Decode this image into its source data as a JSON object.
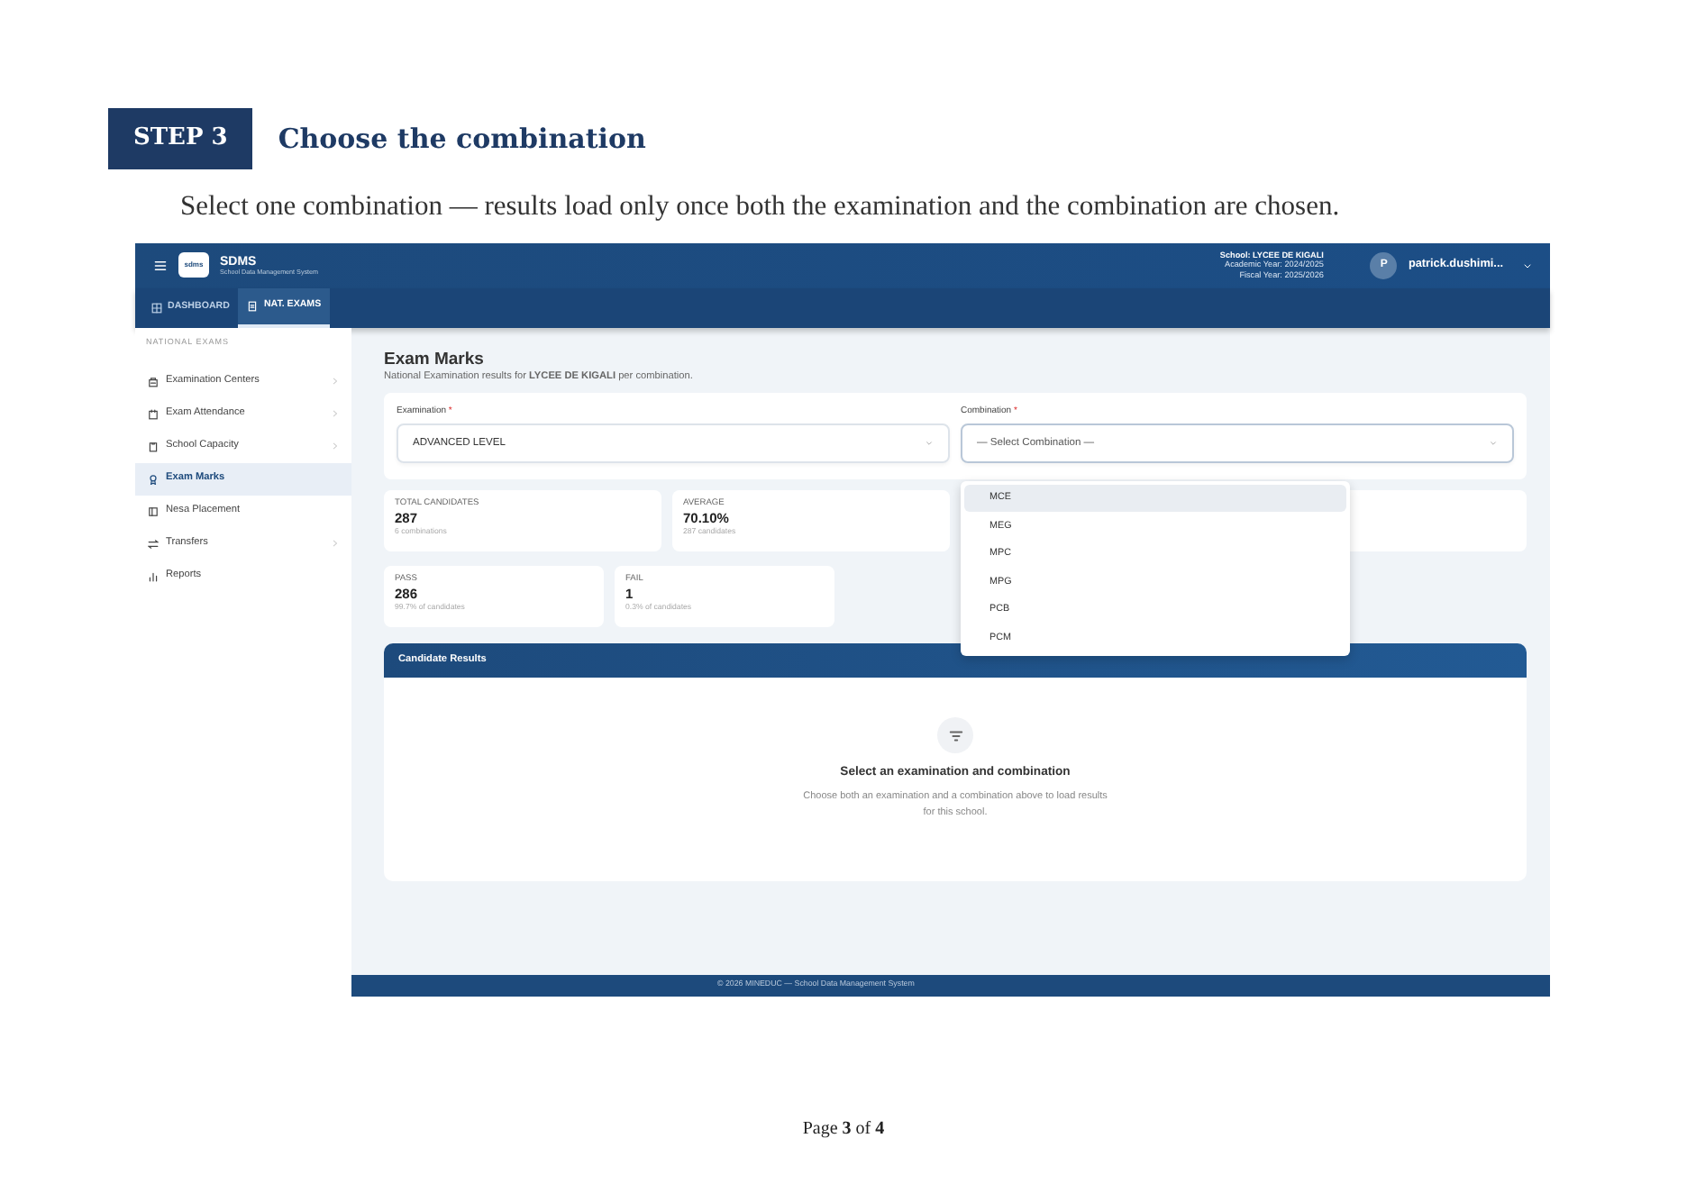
{
  "step": {
    "label": "STEP 3",
    "title": "Choose the combination",
    "caption": "Select one combination — results load only once both the examination and the combination are chosen."
  },
  "app": {
    "brand": {
      "logo": "sdms",
      "name": "SDMS",
      "subtitle": "School Data Management System"
    },
    "school_info": [
      "School: LYCEE DE KIGALI",
      "Academic Year: 2024/2025",
      "Fiscal Year: 2025/2026"
    ],
    "user": {
      "initial": "P",
      "name": "patrick.dushimi..."
    },
    "tabs": [
      {
        "label": "DASHBOARD",
        "selected": false
      },
      {
        "label": "NAT. EXAMS",
        "selected": true
      }
    ],
    "sidebar": {
      "heading": "NATIONAL EXAMS",
      "items": [
        {
          "label": "Examination Centers",
          "selected": false,
          "expandable": true
        },
        {
          "label": "Exam Attendance",
          "selected": false,
          "expandable": true
        },
        {
          "label": "School Capacity",
          "selected": false,
          "expandable": true
        },
        {
          "label": "Exam Marks",
          "selected": true,
          "expandable": false
        },
        {
          "label": "Nesa Placement",
          "selected": false,
          "expandable": false
        },
        {
          "label": "Transfers",
          "selected": false,
          "expandable": true
        },
        {
          "label": "Reports",
          "selected": false,
          "expandable": false
        }
      ]
    },
    "page": {
      "title": "Exam Marks",
      "subtitle": "National Examination results for **LYCEE DE KIGALI** per combination."
    },
    "filters": [
      {
        "label": "Examination",
        "required_mark": "*",
        "value": "ADVANCED LEVEL",
        "expanded": false
      },
      {
        "label": "Combination",
        "required_mark": "*",
        "placeholder": "— Select Combination —",
        "expanded": true,
        "options": [
          {
            "label": "MCE",
            "selected": true
          },
          {
            "label": "MEG",
            "selected": false
          },
          {
            "label": "MPC",
            "selected": false
          },
          {
            "label": "MPG",
            "selected": false
          },
          {
            "label": "PCB",
            "selected": false
          },
          {
            "label": "PCM",
            "selected": false
          }
        ]
      }
    ],
    "stats": [
      {
        "label": "TOTAL CANDIDATES",
        "value": "287",
        "note": "6 combinations"
      },
      {
        "label": "AVERAGE",
        "value": "70.10%",
        "note": "287 candidates"
      },
      {
        "label": "PASS",
        "value": "286",
        "note": "99.7% of candidates"
      },
      {
        "label": "FAIL",
        "value": "1",
        "note": "0.3% of candidates"
      }
    ],
    "results": {
      "title": "Candidate Results",
      "empty_title": "Select an examination and combination",
      "empty_text": "Choose both an examination and a combination above to load results for this school."
    },
    "footer": "© 2026 MINEDUC — School Data Management System"
  },
  "page_number": "Page **3** of **4**"
}
